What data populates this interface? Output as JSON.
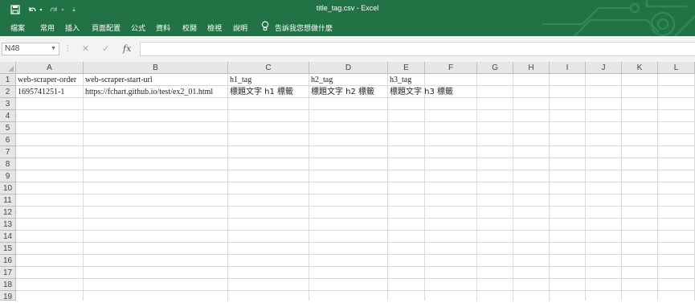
{
  "window": {
    "title": "title_tag.csv  -  Excel",
    "accent": "#217346"
  },
  "quick_access": {
    "save_icon": "save-icon",
    "undo_icon": "undo-icon",
    "redo_icon": "redo-icon",
    "customize_icon": "customize-icon"
  },
  "ribbon": {
    "tabs": [
      "檔案",
      "常用",
      "插入",
      "頁面配置",
      "公式",
      "資料",
      "校閱",
      "檢視",
      "說明"
    ],
    "tell_me": "告訴我您想做什麼"
  },
  "formula_bar": {
    "name_box": "N48",
    "formula": "",
    "cancel_icon": "cancel-icon",
    "enter_icon": "check-icon",
    "fx_label": "fx"
  },
  "sheet": {
    "columns": [
      "A",
      "B",
      "C",
      "D",
      "E",
      "F",
      "G",
      "H",
      "I",
      "J",
      "K",
      "L"
    ],
    "rows": [
      "1",
      "2",
      "3",
      "4",
      "5",
      "6",
      "7",
      "8",
      "9",
      "10",
      "11",
      "12",
      "13",
      "14",
      "15",
      "16",
      "17",
      "18",
      "19"
    ],
    "cells": {
      "A1": "web-scraper-order",
      "B1": "web-scraper-start-url",
      "C1": "h1_tag",
      "D1": "h2_tag",
      "E1": "h3_tag",
      "A2": "1695741251-1",
      "B2": "https://fchart.github.io/test/ex2_01.html",
      "C2": "標題文字 h1 標籤",
      "D2": "標題文字 h2 標籤",
      "E2": "標題文字 h3 標籤"
    }
  }
}
